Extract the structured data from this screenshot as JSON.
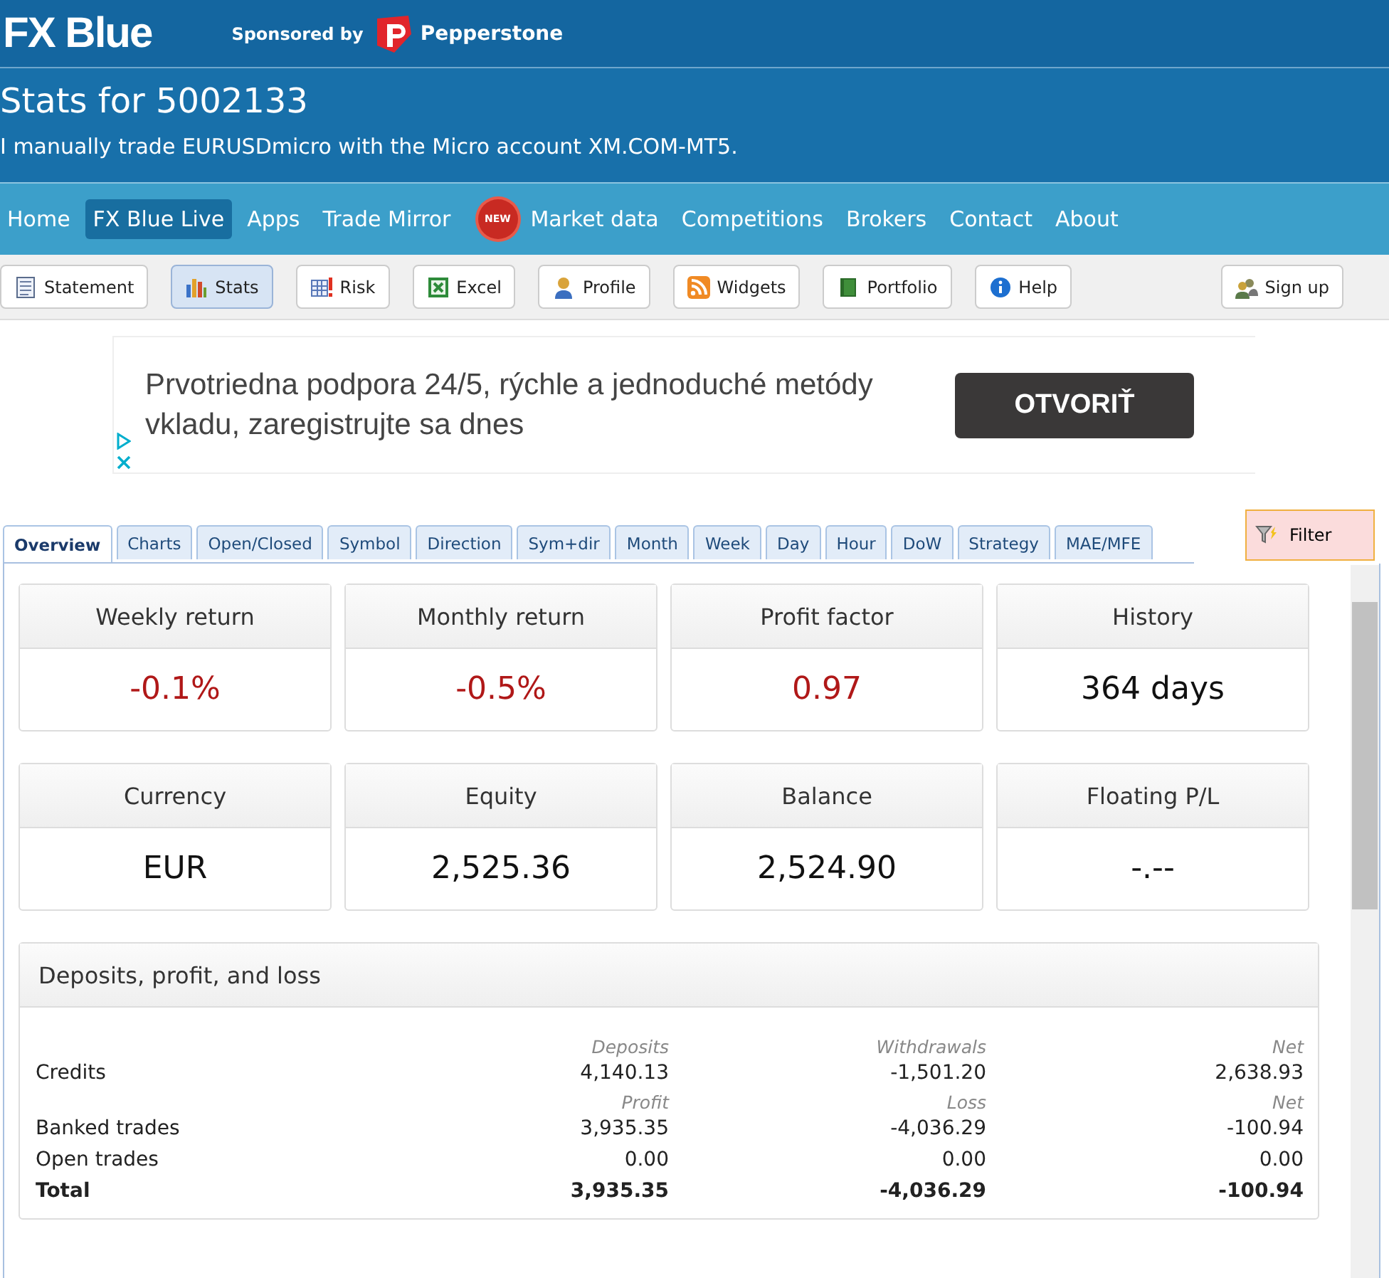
{
  "header": {
    "logo": "FX Blue",
    "sponsor_text": "Sponsored by",
    "sponsor_name": "Pepperstone"
  },
  "title": "Stats for 5002133",
  "subtitle": "I manually trade EURUSDmicro with the Micro account XM.COM-MT5.",
  "nav": [
    {
      "label": "Home",
      "selected": false
    },
    {
      "label": "FX Blue Live",
      "selected": true
    },
    {
      "label": "Apps",
      "selected": false
    },
    {
      "label": "Trade Mirror",
      "selected": false
    },
    {
      "label": "Market data",
      "selected": false,
      "badge": "NEW"
    },
    {
      "label": "Competitions",
      "selected": false
    },
    {
      "label": "Brokers",
      "selected": false
    },
    {
      "label": "Contact",
      "selected": false
    },
    {
      "label": "About",
      "selected": false
    }
  ],
  "toolbar": [
    {
      "label": "Statement",
      "kind": "statement",
      "selected": false
    },
    {
      "label": "Stats",
      "kind": "stats",
      "selected": true
    },
    {
      "label": "Risk",
      "kind": "risk",
      "selected": false
    },
    {
      "label": "Excel",
      "kind": "excel",
      "selected": false
    },
    {
      "label": "Profile",
      "kind": "profile",
      "selected": false
    },
    {
      "label": "Widgets",
      "kind": "widgets",
      "selected": false
    },
    {
      "label": "Portfolio",
      "kind": "portfolio",
      "selected": false
    },
    {
      "label": "Help",
      "kind": "help",
      "selected": false
    },
    {
      "label": "Sign up",
      "kind": "signup",
      "selected": false
    }
  ],
  "ad": {
    "text": "Prvotriedna podpora 24/5, rýchle a jednoduché metódy vkladu, zaregistrujte sa dnes",
    "button": "OTVORIŤ"
  },
  "tabs": [
    {
      "label": "Overview",
      "selected": true
    },
    {
      "label": "Charts",
      "selected": false
    },
    {
      "label": "Open/Closed",
      "selected": false
    },
    {
      "label": "Symbol",
      "selected": false
    },
    {
      "label": "Direction",
      "selected": false
    },
    {
      "label": "Sym+dir",
      "selected": false
    },
    {
      "label": "Month",
      "selected": false
    },
    {
      "label": "Week",
      "selected": false
    },
    {
      "label": "Day",
      "selected": false
    },
    {
      "label": "Hour",
      "selected": false
    },
    {
      "label": "DoW",
      "selected": false
    },
    {
      "label": "Strategy",
      "selected": false
    },
    {
      "label": "MAE/MFE",
      "selected": false
    }
  ],
  "filter_button": "Filter",
  "cards": [
    {
      "label": "Weekly return",
      "value": "-0.1%",
      "negative": true
    },
    {
      "label": "Monthly return",
      "value": "-0.5%",
      "negative": true
    },
    {
      "label": "Profit factor",
      "value": "0.97",
      "negative": true
    },
    {
      "label": "History",
      "value": "364 days",
      "negative": false
    },
    {
      "label": "Currency",
      "value": "EUR",
      "negative": false
    },
    {
      "label": "Equity",
      "value": "2,525.36",
      "negative": false
    },
    {
      "label": "Balance",
      "value": "2,524.90",
      "negative": false
    },
    {
      "label": "Floating P/L",
      "value": "-.--",
      "negative": false
    }
  ],
  "panel": {
    "title": "Deposits, profit, and loss",
    "rows": [
      {
        "kind": "heading",
        "cells": [
          "Deposits",
          "Withdrawals",
          "Net"
        ]
      },
      {
        "kind": "row",
        "label": "Credits",
        "cells": [
          "4,140.13",
          "-1,501.20",
          "2,638.93"
        ]
      },
      {
        "kind": "heading",
        "cells": [
          "Profit",
          "Loss",
          "Net"
        ]
      },
      {
        "kind": "row",
        "label": "Banked trades",
        "cells": [
          "3,935.35",
          "-4,036.29",
          "-100.94"
        ]
      },
      {
        "kind": "row",
        "label": "Open trades",
        "cells": [
          "0.00",
          "0.00",
          "0.00"
        ]
      },
      {
        "kind": "total",
        "label": "Total",
        "cells": [
          "3,935.35",
          "-4,036.29",
          "-100.94"
        ]
      }
    ]
  }
}
